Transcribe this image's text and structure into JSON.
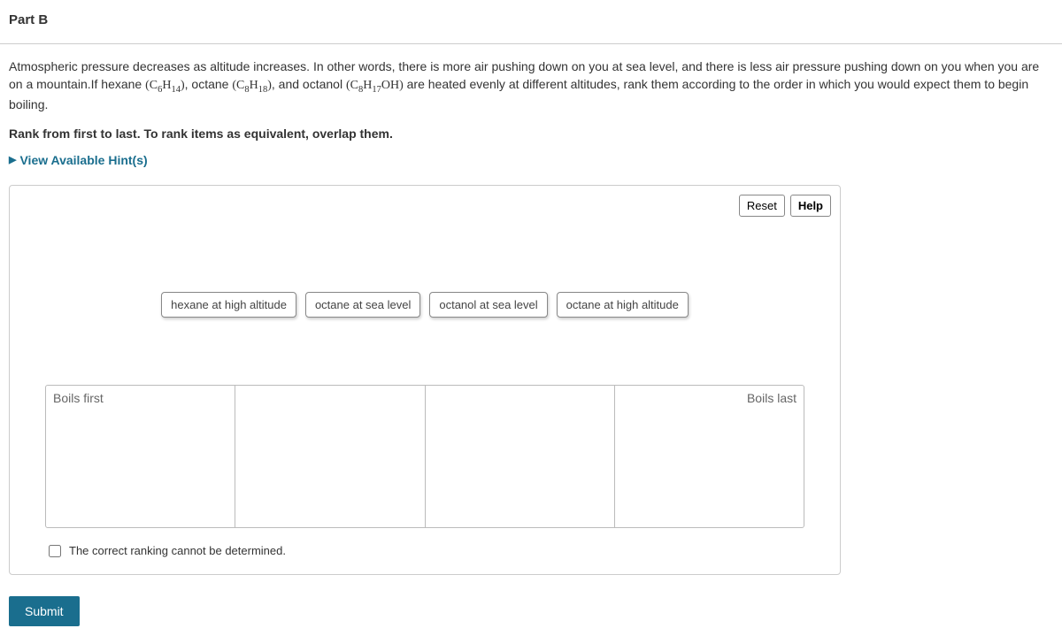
{
  "part_label": "Part B",
  "question_p1_a": "Atmospheric pressure decreases as altitude increases. In other words, there is more air pushing down on you at sea level, and there is less air pressure pushing down on you when you are on a mountain.If hexane ",
  "formula1_base": "(C",
  "formula1_sub1": "6",
  "formula1_mid": "H",
  "formula1_sub2": "14",
  "formula1_end": ")",
  "question_p1_b": ", octane ",
  "formula2_base": "(C",
  "formula2_sub1": "8",
  "formula2_mid": "H",
  "formula2_sub2": "18",
  "formula2_end": ")",
  "question_p1_c": ", and octanol ",
  "formula3_base": "(C",
  "formula3_sub1": "8",
  "formula3_mid": "H",
  "formula3_sub2": "17",
  "formula3_end": "OH)",
  "question_p1_d": " are heated evenly at different altitudes, rank them according to the order in which you would expect them to begin boiling.",
  "rank_instruction": "Rank from first to last. To rank items as equivalent, overlap them.",
  "hints_label": "View Available Hint(s)",
  "controls": {
    "reset": "Reset",
    "help": "Help"
  },
  "items": {
    "item1": "hexane at high altitude",
    "item2": "octane at sea level",
    "item3": "octanol at sea level",
    "item4": "octane at high altitude"
  },
  "bin_labels": {
    "first": "Boils first",
    "last": "Boils last"
  },
  "checkbox_label": "The correct ranking cannot be determined.",
  "submit_label": "Submit"
}
